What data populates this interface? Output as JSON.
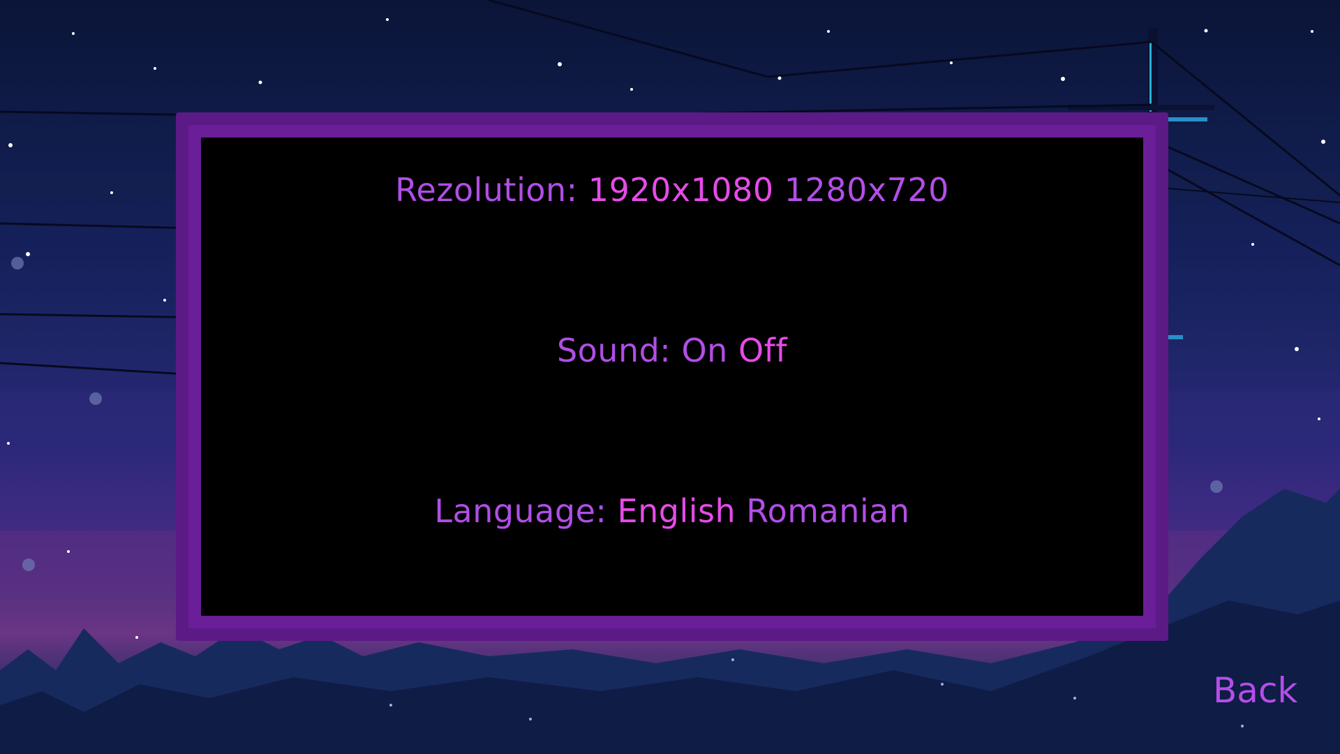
{
  "settings": {
    "resolution": {
      "label": "Rezolution:",
      "options": [
        "1920x1080",
        "1280x720"
      ],
      "selected": "1920x1080"
    },
    "sound": {
      "label": "Sound:",
      "options": [
        "On",
        "Off"
      ],
      "selected": "Off"
    },
    "language": {
      "label": "Language:",
      "options": [
        "English",
        "Romanian"
      ],
      "selected": "English"
    }
  },
  "navigation": {
    "back_label": "Back"
  },
  "colors": {
    "panel_outer": "#5c1a86",
    "panel_inner": "#6a1e98",
    "panel_content": "#000000",
    "label_text": "#b04ee6",
    "selected_text": "#e64be8",
    "unselected_text": "#b24ee8"
  }
}
